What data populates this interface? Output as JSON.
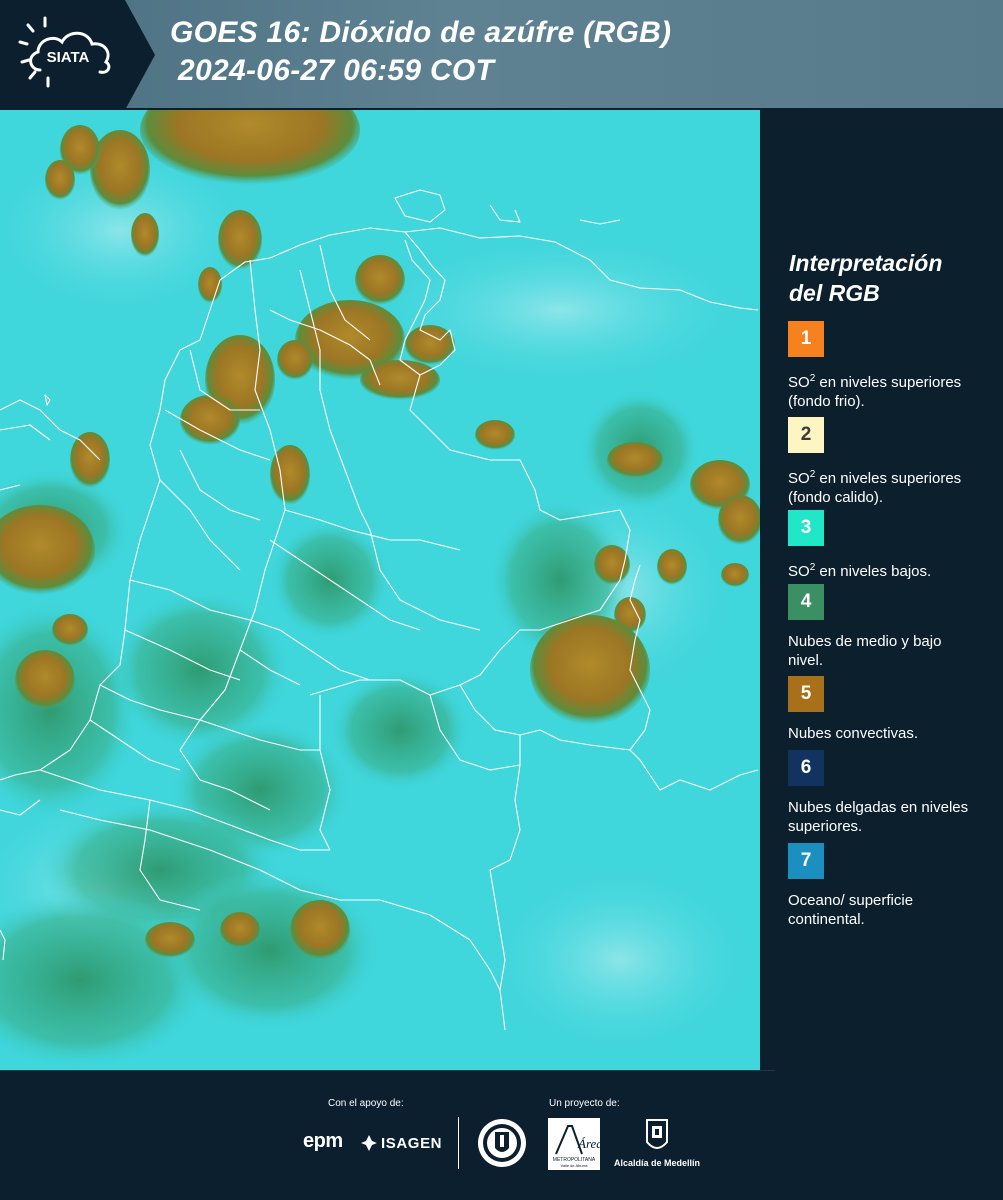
{
  "header": {
    "logo_text": "SIATA",
    "title": "GOES 16: Dióxido de azúfre (RGB)",
    "subtitle": "2024-06-27 06:59 COT"
  },
  "map": {
    "description_icon": "satellite-rgb-map",
    "background_color": "#3fd6dc",
    "cloud_color": "#a57a25",
    "low_cloud_color": "#3d9a6c",
    "border_color": "#ffffff"
  },
  "legend": {
    "title_line1": "Interpretación",
    "title_line2": "del RGB",
    "items": [
      {
        "number": "1",
        "color": "#f5821f",
        "text": "SO² en niveles superiores (fondo frio)."
      },
      {
        "number": "2",
        "color": "#fdf6c3",
        "text": "SO² en niveles superiores (fondo calido)."
      },
      {
        "number": "3",
        "color": "#22e6c8",
        "text": "SO² en niveles bajos."
      },
      {
        "number": "4",
        "color": "#3a8f63",
        "text": "Nubes de medio y bajo nivel."
      },
      {
        "number": "5",
        "color": "#a8701a",
        "text": "Nubes convectivas."
      },
      {
        "number": "6",
        "color": "#12335f",
        "text": "Nubes delgadas en niveles superiores."
      },
      {
        "number": "7",
        "color": "#1b8fc0",
        "text": "Oceano/ superficie continental."
      }
    ]
  },
  "footer": {
    "support_label": "Con el apoyo de:",
    "project_label": "Un proyecto de:",
    "sponsor1": "epm",
    "sponsor2": "ISAGEN",
    "alcaldia": "Alcaldía de Medellín",
    "area_logo_text": "Área",
    "area_logo_sub": "METROPOLITANA",
    "area_logo_sub2": "Valle de Aburrá"
  }
}
